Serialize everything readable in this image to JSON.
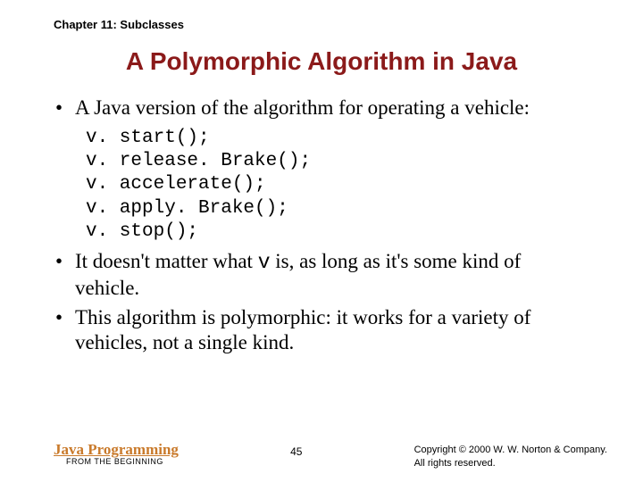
{
  "header": {
    "chapter": "Chapter 11: Subclasses"
  },
  "title": "A Polymorphic Algorithm in Java",
  "bullets": {
    "b1": "A Java version of the algorithm for operating a vehicle:",
    "b2a": "It doesn't matter what ",
    "b2code": "v",
    "b2b": " is, as long as it's some kind of vehicle.",
    "b3": "This algorithm is polymorphic: it works for a variety of vehicles, not a single kind."
  },
  "code": {
    "l1": "v. start();",
    "l2": "v. release. Brake();",
    "l3": "v. accelerate();",
    "l4": "v. apply. Brake();",
    "l5": "v. stop();"
  },
  "footer": {
    "book_title": "Java Programming",
    "book_sub": "FROM THE BEGINNING",
    "page": "45",
    "copyright_l1": "Copyright © 2000 W. W. Norton & Company.",
    "copyright_l2": "All rights reserved."
  }
}
